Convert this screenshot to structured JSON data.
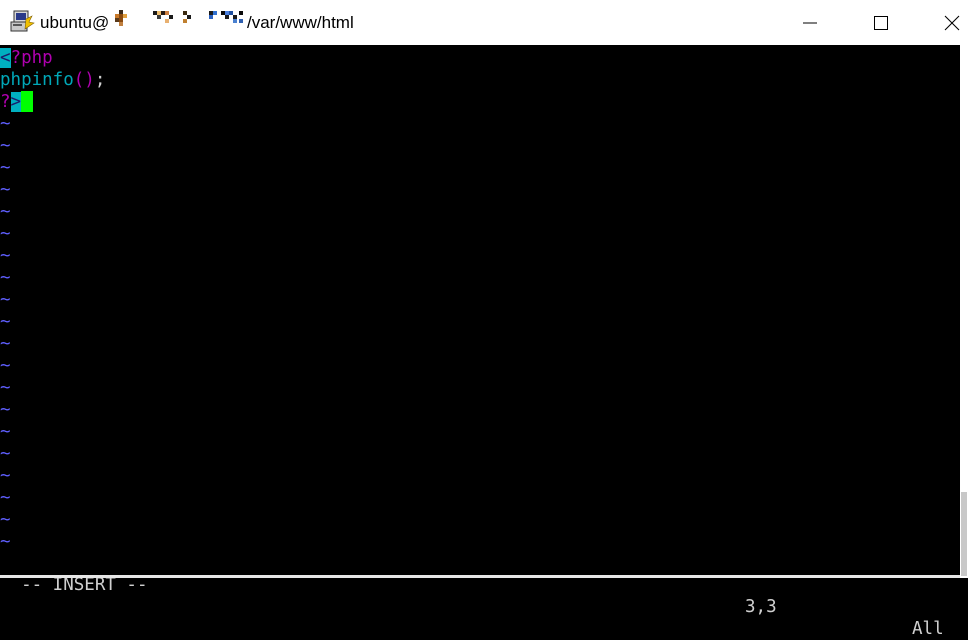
{
  "window": {
    "title_prefix": "ubuntu@",
    "title_suffix": "/var/www/html"
  },
  "editor": {
    "line1": {
      "open_bracket": "<",
      "rest": "?php"
    },
    "line2": {
      "func": "phpinfo",
      "parens": "()",
      "semicolon": ";"
    },
    "line3": {
      "question": "?",
      "close_bracket": ">"
    },
    "empty_line_marker": "~"
  },
  "status": {
    "mode": "-- INSERT --",
    "position": "3,3",
    "scroll": "All"
  },
  "colors": {
    "keyword": "#b000b0",
    "function": "#00a8b8",
    "tilde": "#5f5fff",
    "cursor": "#00ff00",
    "bracket_highlight": "#00b0c0"
  }
}
